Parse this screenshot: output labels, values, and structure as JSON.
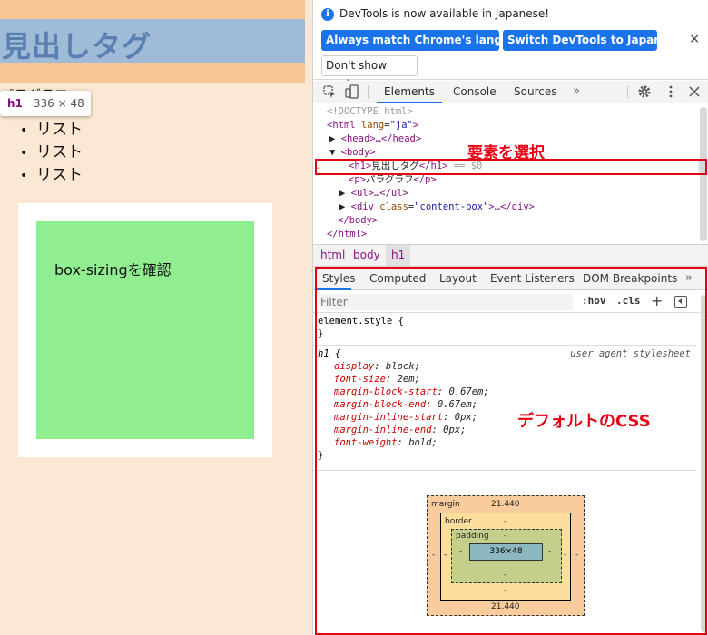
{
  "page": {
    "h1_text": "見出しタグ",
    "paragraph": "パラグラフ",
    "tooltip": {
      "tag": "h1",
      "size": "336 × 48"
    },
    "list_items": [
      "リスト",
      "リスト",
      "リスト"
    ],
    "content_box_text": "box-sizingを確認"
  },
  "devtools": {
    "info_bar": {
      "message": "DevTools is now available in Japanese!",
      "match_button": "Always match Chrome's language",
      "switch_button": "Switch DevTools to Japanese",
      "dont_show_button": "Don't show again",
      "close": "×"
    },
    "tabs": {
      "elements": "Elements",
      "console": "Console",
      "sources": "Sources",
      "more": "»"
    },
    "dom": {
      "doctype": "<!DOCTYPE html>",
      "html_open_tag": "<html",
      "lang_attr": "lang",
      "lang_val": "\"ja\"",
      "head": "<head>…</head>",
      "body_open": "<body>",
      "h1_open": "<h1>",
      "h1_text": "見出しタグ",
      "h1_close": "</h1>",
      "h1_suffix": "== $0",
      "p_open": "<p>",
      "p_text": "パラグラフ",
      "p_close": "</p>",
      "ul": "<ul>…</ul>",
      "div_open": "<div",
      "class_attr": "class",
      "class_val": "\"content-box\"",
      "div_rest": ">…</div>",
      "body_close": "</body>",
      "html_close": "</html>",
      "dots": "…"
    },
    "annotation_select": "要素を選択",
    "breadcrumbs": [
      "html",
      "body",
      "h1"
    ],
    "styles_tabs": {
      "styles": "Styles",
      "computed": "Computed",
      "layout": "Layout",
      "events": "Event Listeners",
      "dom_breakpoints": "DOM Breakpoints",
      "more": "»"
    },
    "filter_placeholder": "Filter",
    "hov": ":hov",
    "cls": ".cls",
    "element_style": {
      "selector": "element.style {",
      "close": "}"
    },
    "h1_rule": {
      "selector": "h1 {",
      "source": "user agent stylesheet",
      "props": [
        {
          "name": "display",
          "value": "block;"
        },
        {
          "name": "font-size",
          "value": "2em;"
        },
        {
          "name": "margin-block-start",
          "value": "0.67em;"
        },
        {
          "name": "margin-block-end",
          "value": "0.67em;"
        },
        {
          "name": "margin-inline-start",
          "value": "0px;"
        },
        {
          "name": "margin-inline-end",
          "value": "0px;"
        },
        {
          "name": "font-weight",
          "value": "bold;"
        }
      ],
      "close": "}"
    },
    "annotation_css": "デフォルトのCSS",
    "box_model": {
      "margin_label": "margin",
      "margin_top": "21.440",
      "margin_bottom": "21.440",
      "margin_side": "-",
      "border_label": "border",
      "border_value": "-",
      "padding_label": "padding",
      "padding_value": "-",
      "content": "336×48"
    }
  }
}
